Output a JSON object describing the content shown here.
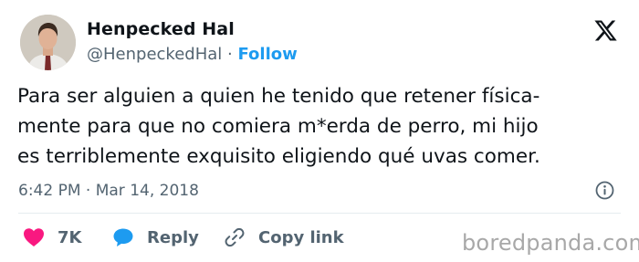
{
  "author": {
    "display_name": "Henpecked Hal",
    "handle": "@HenpeckedHal",
    "separator": "·",
    "follow_label": "Follow",
    "avatar_icon": "profile-photo"
  },
  "tweet": {
    "text_lines": [
      "Para ser alguien a quien he tenido que retener física-",
      "mente para que no comiera m*erda de perro, mi hijo",
      "es  terriblemente exquisito eligiendo qué uvas comer."
    ],
    "timestamp": "6:42 PM · Mar 14, 2018"
  },
  "actions": {
    "like_count": "7K",
    "reply_label": "Reply",
    "copy_link_label": "Copy link"
  },
  "icons": {
    "logo": "x-logo-icon",
    "info": "info-icon",
    "like": "heart-icon",
    "reply": "speech-bubble-icon",
    "copy": "link-icon"
  },
  "colors": {
    "accent": "#1d9bf0",
    "heart": "#f91880",
    "text": "#0f1419",
    "muted": "#536471",
    "divider": "#e6ecf0",
    "watermark": "#a8a8a8"
  },
  "watermark": {
    "text": "boredpanda.com"
  }
}
